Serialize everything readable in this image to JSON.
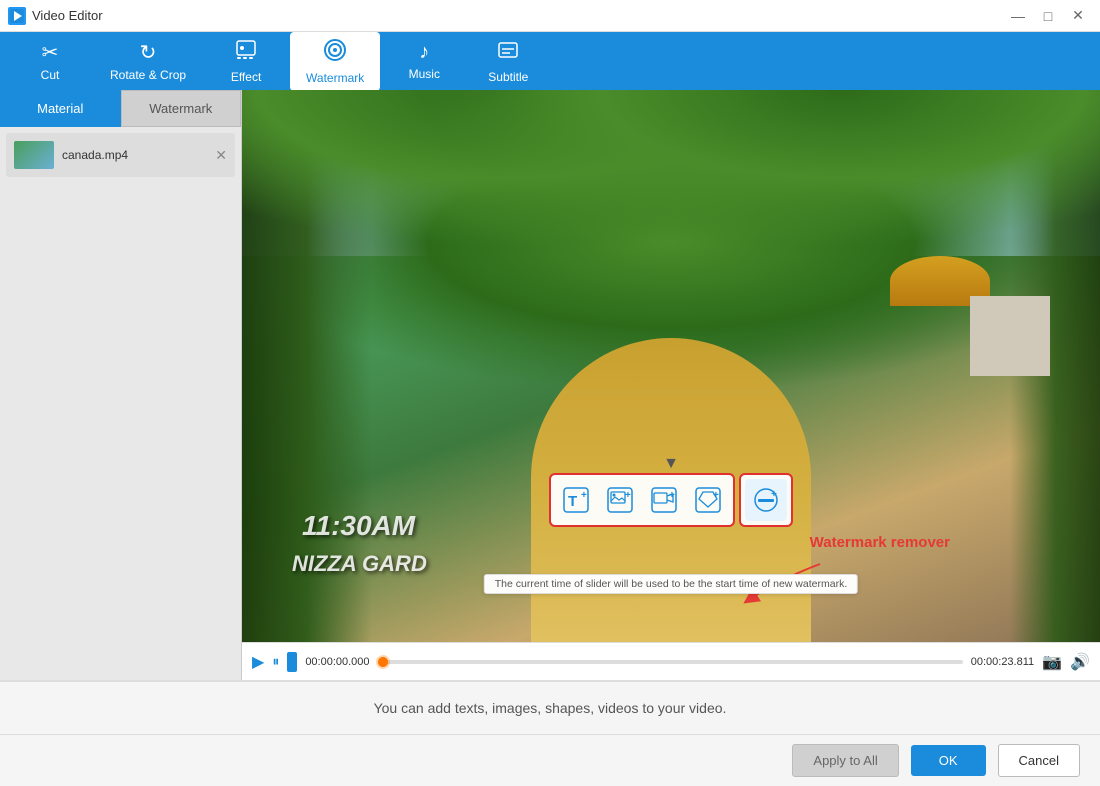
{
  "titleBar": {
    "title": "Video Editor",
    "minimize": "—",
    "maximize": "□",
    "close": "✕"
  },
  "tabs": [
    {
      "id": "cut",
      "label": "Cut",
      "icon": "✂",
      "active": false
    },
    {
      "id": "rotate",
      "label": "Rotate & Crop",
      "icon": "⟳",
      "active": false
    },
    {
      "id": "effect",
      "label": "Effect",
      "icon": "🎞",
      "active": false
    },
    {
      "id": "watermark",
      "label": "Watermark",
      "icon": "🎬",
      "active": true
    },
    {
      "id": "music",
      "label": "Music",
      "icon": "♪",
      "active": false
    },
    {
      "id": "subtitle",
      "label": "Subtitle",
      "icon": "💬",
      "active": false
    }
  ],
  "sidebar": {
    "tabs": [
      "Material",
      "Watermark"
    ],
    "activeTab": 0
  },
  "videoFile": "canada.mp4",
  "watermarkText": "11:30AM",
  "watermarkSubtext": "NIZZA GARD",
  "timeStart": "00:00:00.000",
  "timeEnd": "00:00:23.811",
  "tooltipMessage": "The current time of slider will be used to be the start time of new watermark.",
  "watermarkRemoverLabel": "Watermark remover",
  "bottomInfo": "You can add texts, images, shapes, videos to your video.",
  "footer": {
    "applyToAll": "Apply to All",
    "ok": "OK",
    "cancel": "Cancel"
  },
  "toolbar": {
    "addText": "T+",
    "addImage": "🖼+",
    "addVideo": "▶+",
    "addShape": "✦+",
    "watermarkRemove": "🚫"
  }
}
